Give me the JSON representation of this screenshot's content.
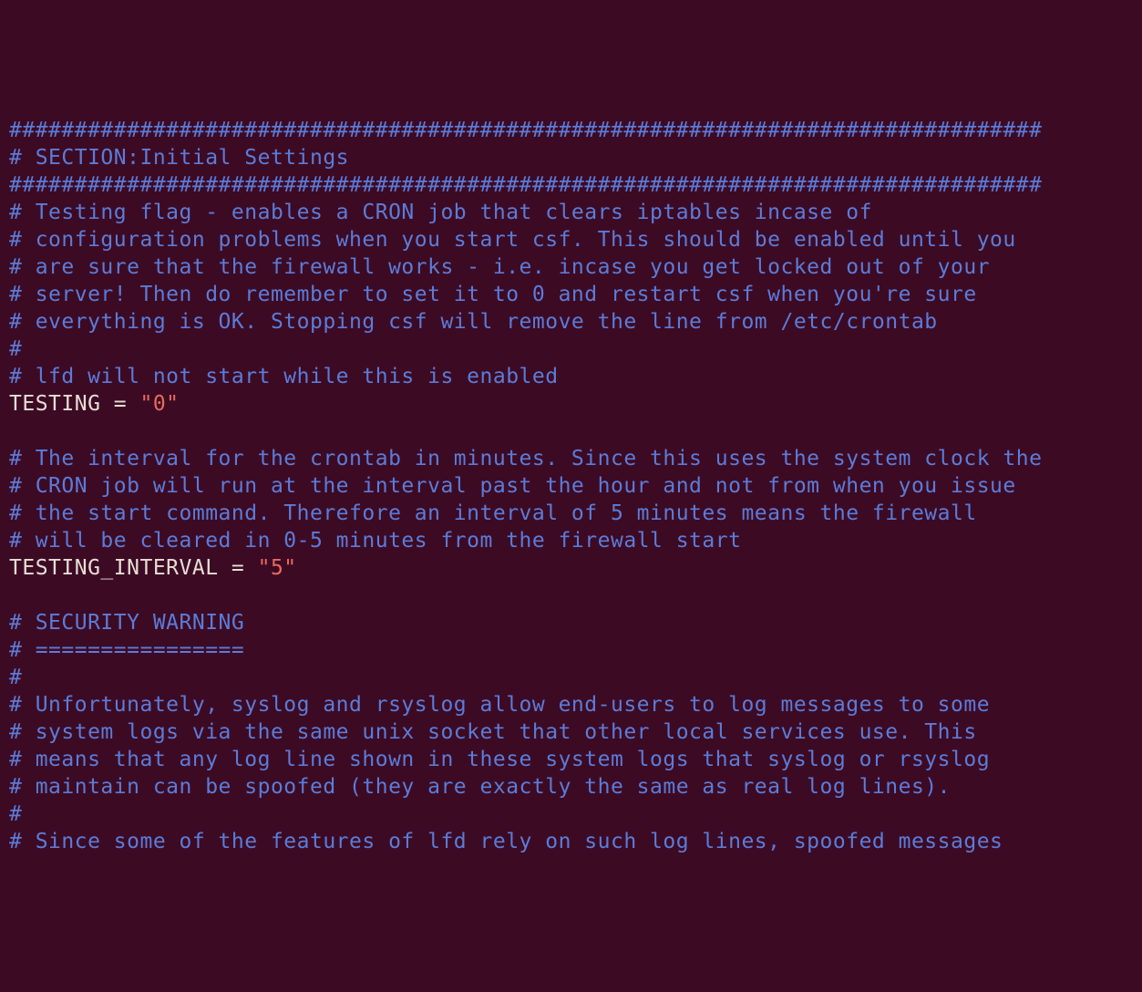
{
  "config_file": {
    "lines": [
      {
        "type": "comment",
        "text": "###############################################################################"
      },
      {
        "type": "comment",
        "text": "# SECTION:Initial Settings"
      },
      {
        "type": "comment",
        "text": "###############################################################################"
      },
      {
        "type": "comment",
        "text": "# Testing flag - enables a CRON job that clears iptables incase of"
      },
      {
        "type": "comment",
        "text": "# configuration problems when you start csf. This should be enabled until you"
      },
      {
        "type": "comment",
        "text": "# are sure that the firewall works - i.e. incase you get locked out of your"
      },
      {
        "type": "comment",
        "text": "# server! Then do remember to set it to 0 and restart csf when you're sure"
      },
      {
        "type": "comment",
        "text": "# everything is OK. Stopping csf will remove the line from /etc/crontab"
      },
      {
        "type": "comment",
        "text": "#"
      },
      {
        "type": "comment",
        "text": "# lfd will not start while this is enabled"
      },
      {
        "type": "kv",
        "key": "TESTING = ",
        "value": "\"0\""
      },
      {
        "type": "blank",
        "text": ""
      },
      {
        "type": "comment",
        "text": "# The interval for the crontab in minutes. Since this uses the system clock the"
      },
      {
        "type": "comment",
        "text": "# CRON job will run at the interval past the hour and not from when you issue"
      },
      {
        "type": "comment",
        "text": "# the start command. Therefore an interval of 5 minutes means the firewall"
      },
      {
        "type": "comment",
        "text": "# will be cleared in 0-5 minutes from the firewall start"
      },
      {
        "type": "kv",
        "key": "TESTING_INTERVAL = ",
        "value": "\"5\""
      },
      {
        "type": "blank",
        "text": ""
      },
      {
        "type": "comment",
        "text": "# SECURITY WARNING"
      },
      {
        "type": "comment",
        "text": "# ================"
      },
      {
        "type": "comment",
        "text": "#"
      },
      {
        "type": "comment",
        "text": "# Unfortunately, syslog and rsyslog allow end-users to log messages to some"
      },
      {
        "type": "comment",
        "text": "# system logs via the same unix socket that other local services use. This"
      },
      {
        "type": "comment",
        "text": "# means that any log line shown in these system logs that syslog or rsyslog"
      },
      {
        "type": "comment",
        "text": "# maintain can be spoofed (they are exactly the same as real log lines)."
      },
      {
        "type": "comment",
        "text": "#"
      },
      {
        "type": "comment",
        "text": "# Since some of the features of lfd rely on such log lines, spoofed messages"
      }
    ]
  },
  "colors": {
    "background": "#3d0a24",
    "comment": "#5b7cd8",
    "key": "#e6ded4",
    "string": "#e86a5e"
  }
}
